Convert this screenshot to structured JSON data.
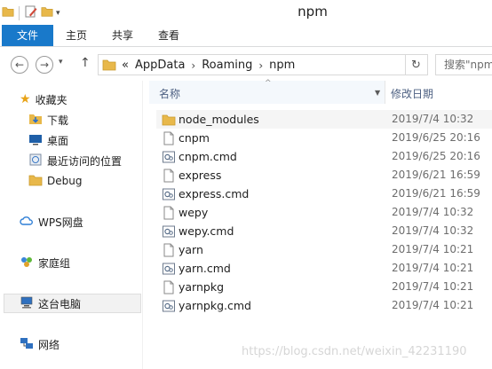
{
  "window": {
    "title": "npm"
  },
  "ribbon": {
    "tabs": [
      "文件",
      "主页",
      "共享",
      "查看"
    ]
  },
  "address": {
    "prefix": "«",
    "crumbs": [
      "AppData",
      "Roaming",
      "npm"
    ],
    "search_placeholder": "搜索\"npm\""
  },
  "nav": {
    "quick_access": "收藏夹",
    "quick_items": [
      "下载",
      "桌面",
      "最近访问的位置",
      "Debug"
    ],
    "wps": "WPS网盘",
    "homegroup": "家庭组",
    "this_pc": "这台电脑",
    "network": "网络"
  },
  "columns": {
    "name": "名称",
    "date": "修改日期"
  },
  "files": [
    {
      "name": "node_modules",
      "date": "2019/7/4 10:32",
      "icon": "folder-icon"
    },
    {
      "name": "cnpm",
      "date": "2019/6/25 20:16",
      "icon": "file-icon"
    },
    {
      "name": "cnpm.cmd",
      "date": "2019/6/25 20:16",
      "icon": "cmd-file-icon"
    },
    {
      "name": "express",
      "date": "2019/6/21 16:59",
      "icon": "file-icon"
    },
    {
      "name": "express.cmd",
      "date": "2019/6/21 16:59",
      "icon": "cmd-file-icon"
    },
    {
      "name": "wepy",
      "date": "2019/7/4 10:32",
      "icon": "file-icon"
    },
    {
      "name": "wepy.cmd",
      "date": "2019/7/4 10:32",
      "icon": "cmd-file-icon"
    },
    {
      "name": "yarn",
      "date": "2019/7/4 10:21",
      "icon": "file-icon"
    },
    {
      "name": "yarn.cmd",
      "date": "2019/7/4 10:21",
      "icon": "cmd-file-icon"
    },
    {
      "name": "yarnpkg",
      "date": "2019/7/4 10:21",
      "icon": "file-icon"
    },
    {
      "name": "yarnpkg.cmd",
      "date": "2019/7/4 10:21",
      "icon": "cmd-file-icon"
    }
  ],
  "watermark": "https://blog.csdn.net/weixin_42231190",
  "colors": {
    "file_tab": "#1979ca",
    "folder": "#e8b84a",
    "header_text": "#4d6082"
  }
}
